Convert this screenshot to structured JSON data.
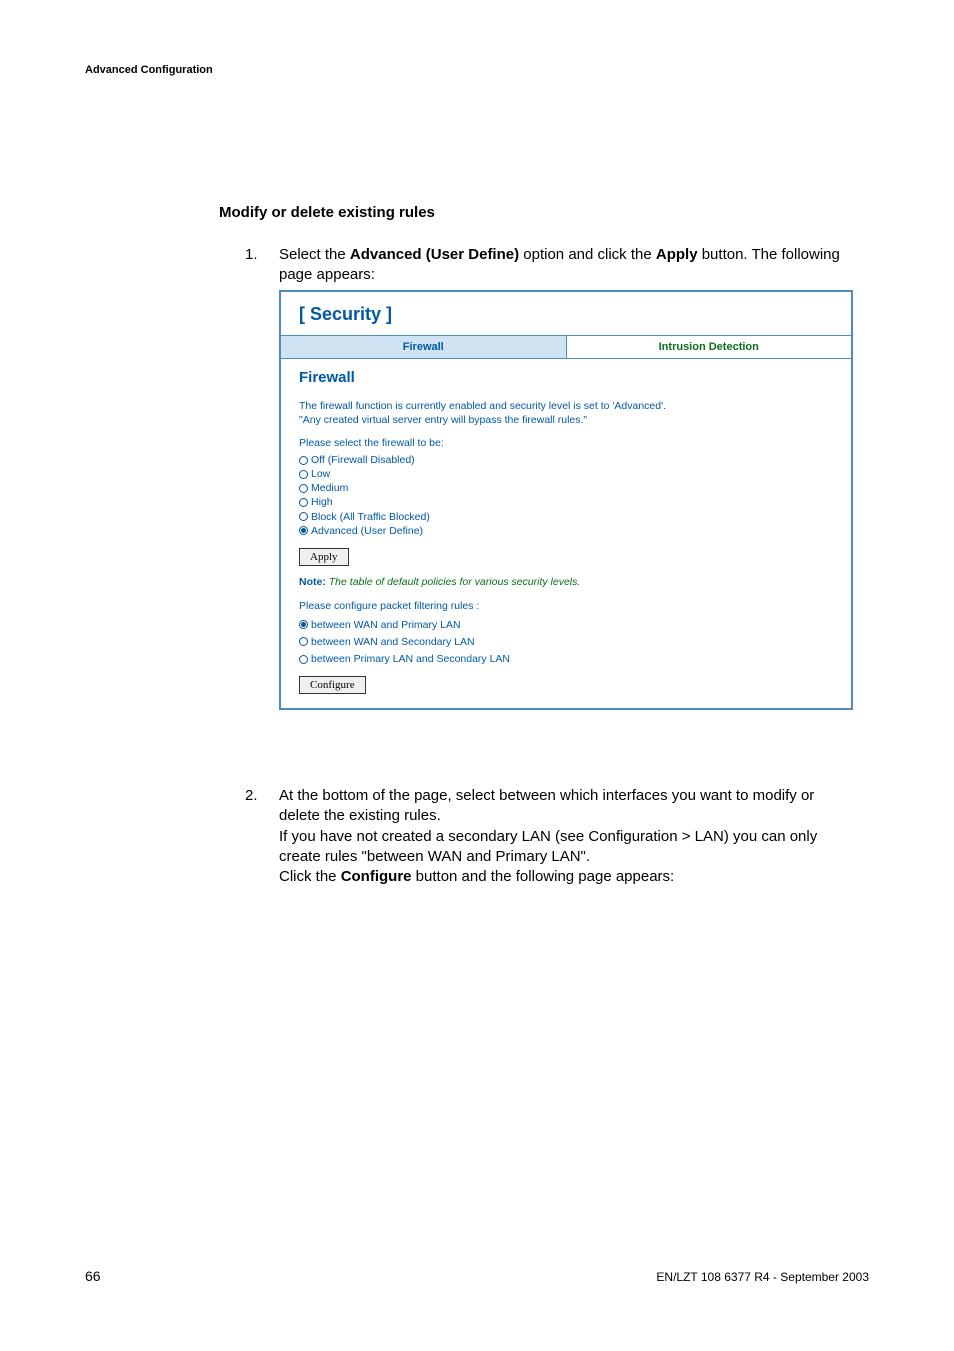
{
  "header": "Advanced Configuration",
  "section_title": "Modify or delete existing rules",
  "step1": {
    "num": "1.",
    "prefix": "Select the ",
    "bold1": "Advanced (User Define)",
    "mid": " option and click the ",
    "bold2": "Apply",
    "suffix": " button. The following page appears:"
  },
  "screenshot": {
    "title": "[ Security ]",
    "tab_firewall": "Firewall",
    "tab_intrusion": "Intrusion Detection",
    "subtitle": "Firewall",
    "status_line1": "The firewall function is currently enabled and security level is set to 'Advanced'.",
    "status_line2": "\"Any created virtual server entry will bypass the firewall rules.\"",
    "select_prompt": "Please select the firewall to be:",
    "radios1": [
      {
        "label": "Off (Firewall Disabled)",
        "selected": false
      },
      {
        "label": "Low",
        "selected": false
      },
      {
        "label": "Medium",
        "selected": false
      },
      {
        "label": "High",
        "selected": false
      },
      {
        "label": "Block (All Traffic Blocked)",
        "selected": false
      },
      {
        "label": "Advanced (User Define)",
        "selected": true
      }
    ],
    "apply_btn": "Apply",
    "note_bold": "Note:",
    "note_text": "The table of default policies for various security levels.",
    "configure_prompt": "Please configure packet filtering rules :",
    "radios2": [
      {
        "label": "between WAN and Primary LAN",
        "selected": true
      },
      {
        "label": "between WAN and Secondary LAN",
        "selected": false
      },
      {
        "label": "between Primary LAN and Secondary LAN",
        "selected": false
      }
    ],
    "configure_btn": "Configure"
  },
  "step2": {
    "num": "2.",
    "line1": "At the bottom of the page, select between which interfaces you want to modify or delete the existing rules.",
    "line2": "If you have not created a secondary LAN (see Configuration > LAN) you can only create rules \"between WAN and Primary LAN\".",
    "line3_prefix": "Click the ",
    "line3_bold": "Configure",
    "line3_suffix": " button and the following page appears:"
  },
  "footer": {
    "page": "66",
    "right": "EN/LZT 108 6377 R4 - September 2003"
  }
}
